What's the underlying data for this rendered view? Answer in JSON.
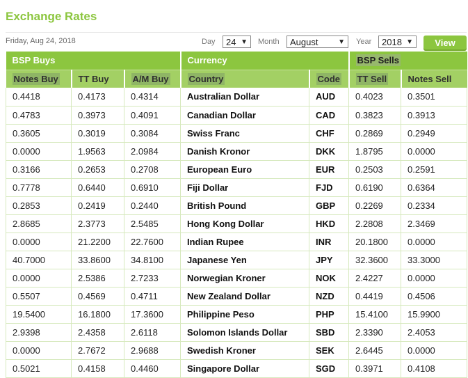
{
  "page": {
    "title": "Exchange Rates",
    "date": "Friday, Aug 24, 2018"
  },
  "filters": {
    "day_label": "Day",
    "day_value": "24",
    "month_label": "Month",
    "month_value": "August",
    "year_label": "Year",
    "year_value": "2018",
    "view_label": "View"
  },
  "table": {
    "groups": [
      "BSP Buys",
      "Currency",
      "BSP Sells"
    ],
    "columns": [
      "Notes Buy",
      "TT Buy",
      "A/M Buy",
      "Country",
      "Code",
      "TT Sell",
      "Notes Sell"
    ],
    "rows": [
      [
        "0.4418",
        "0.4173",
        "0.4314",
        "Australian Dollar",
        "AUD",
        "0.4023",
        "0.3501"
      ],
      [
        "0.4783",
        "0.3973",
        "0.4091",
        "Canadian Dollar",
        "CAD",
        "0.3823",
        "0.3913"
      ],
      [
        "0.3605",
        "0.3019",
        "0.3084",
        "Swiss Franc",
        "CHF",
        "0.2869",
        "0.2949"
      ],
      [
        "0.0000",
        "1.9563",
        "2.0984",
        "Danish Kronor",
        "DKK",
        "1.8795",
        "0.0000"
      ],
      [
        "0.3166",
        "0.2653",
        "0.2708",
        "European Euro",
        "EUR",
        "0.2503",
        "0.2591"
      ],
      [
        "0.7778",
        "0.6440",
        "0.6910",
        "Fiji Dollar",
        "FJD",
        "0.6190",
        "0.6364"
      ],
      [
        "0.2853",
        "0.2419",
        "0.2440",
        "British Pound",
        "GBP",
        "0.2269",
        "0.2334"
      ],
      [
        "2.8685",
        "2.3773",
        "2.5485",
        "Hong Kong Dollar",
        "HKD",
        "2.2808",
        "2.3469"
      ],
      [
        "0.0000",
        "21.2200",
        "22.7600",
        "Indian Rupee",
        "INR",
        "20.1800",
        "0.0000"
      ],
      [
        "40.7000",
        "33.8600",
        "34.8100",
        "Japanese Yen",
        "JPY",
        "32.3600",
        "33.3000"
      ],
      [
        "0.0000",
        "2.5386",
        "2.7233",
        "Norwegian Kroner",
        "NOK",
        "2.4227",
        "0.0000"
      ],
      [
        "0.5507",
        "0.4569",
        "0.4711",
        "New Zealand Dollar",
        "NZD",
        "0.4419",
        "0.4506"
      ],
      [
        "19.5400",
        "16.1800",
        "17.3600",
        "Philippine Peso",
        "PHP",
        "15.4100",
        "15.9900"
      ],
      [
        "2.9398",
        "2.4358",
        "2.6118",
        "Solomon Islands Dollar",
        "SBD",
        "2.3390",
        "2.4053"
      ],
      [
        "0.0000",
        "2.7672",
        "2.9688",
        "Swedish Kroner",
        "SEK",
        "2.6445",
        "0.0000"
      ],
      [
        "0.5021",
        "0.4158",
        "0.4460",
        "Singapore Dollar",
        "SGD",
        "0.3971",
        "0.4108"
      ]
    ]
  }
}
